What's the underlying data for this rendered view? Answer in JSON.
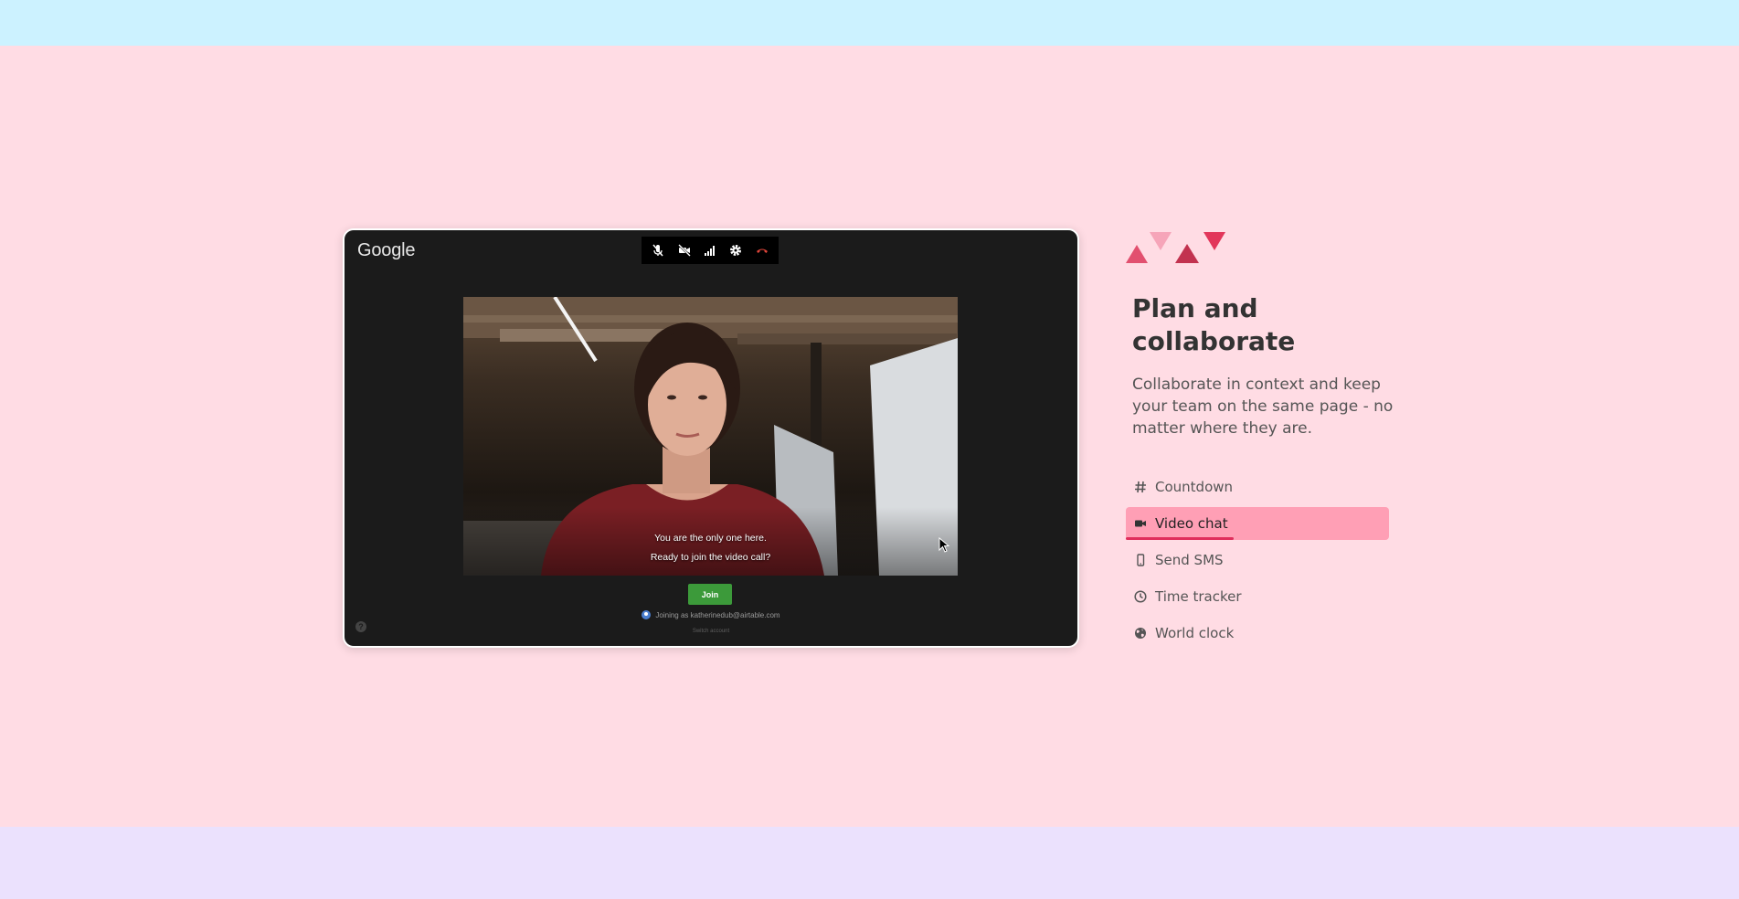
{
  "colors": {
    "top_band": "#ccf2ff",
    "page_background": "#ffdce4",
    "bottom_band": "#ebe1fd",
    "active_item": "#ff9fb5",
    "active_underline": "#e02e5c",
    "join_button": "#3c9a3a",
    "hangup": "#e0453a"
  },
  "video_panel": {
    "logo": "Google",
    "toolbar": {
      "icons": [
        "mic-off-icon",
        "camera-off-icon",
        "signal-icon",
        "gear-icon",
        "hang-up-icon"
      ]
    },
    "message_line1": "You are the only one here.",
    "message_line2": "Ready to join the video call?",
    "join_label": "Join",
    "joining_as": "Joining as katherinedub@airtable.com",
    "switch_account": "Switch account",
    "help": "?"
  },
  "feature": {
    "title": "Plan and collaborate",
    "description": "Collaborate in context and keep your team on the same page - no matter where they are.",
    "items": [
      {
        "label": "Countdown",
        "icon": "hash-icon",
        "active": false
      },
      {
        "label": "Video chat",
        "icon": "video-camera-icon",
        "active": true
      },
      {
        "label": "Send SMS",
        "icon": "phone-icon",
        "active": false
      },
      {
        "label": "Time tracker",
        "icon": "clock-icon",
        "active": false
      },
      {
        "label": "World clock",
        "icon": "globe-icon",
        "active": false
      }
    ]
  }
}
